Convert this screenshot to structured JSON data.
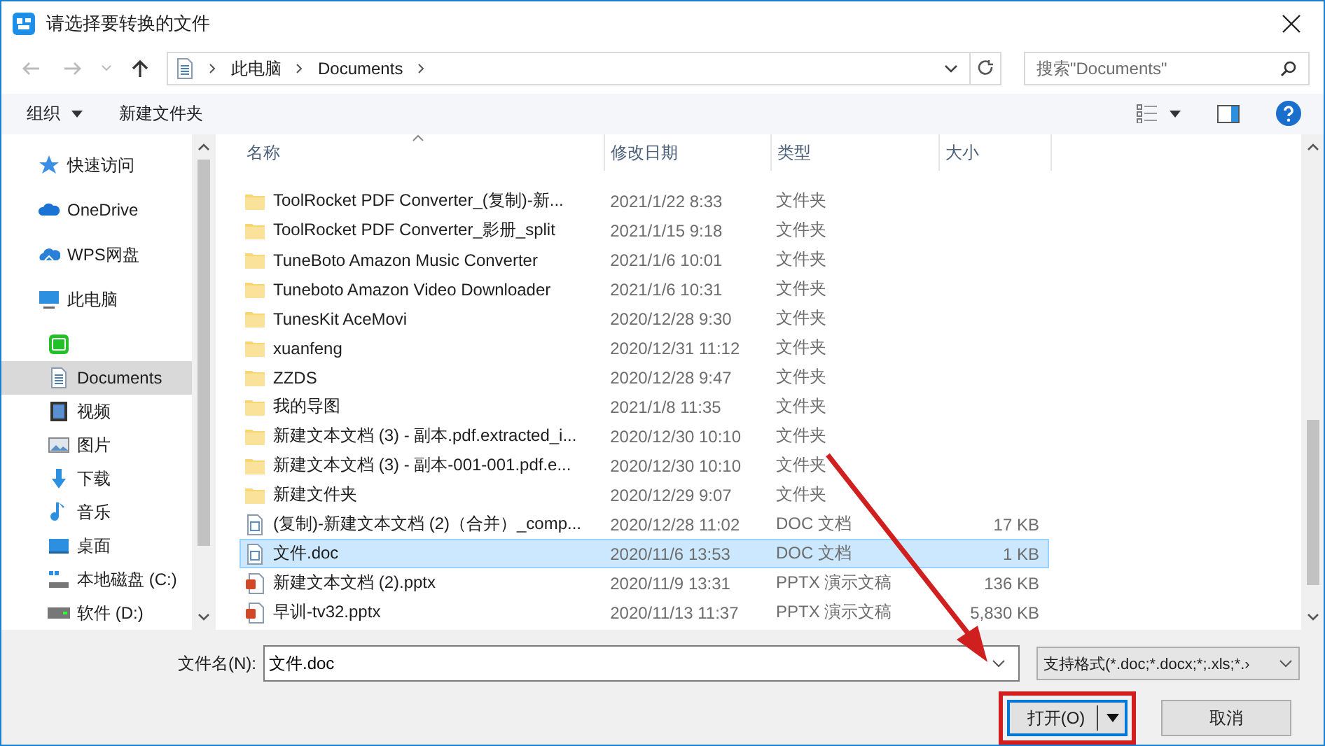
{
  "window": {
    "title": "请选择要转换的文件"
  },
  "address_bar": {
    "path": [
      "此电脑",
      "Documents"
    ],
    "search": {
      "placeholder": "搜索\"Documents\""
    }
  },
  "toolbar": {
    "organize": "组织",
    "new_folder": "新建文件夹"
  },
  "sidebar": {
    "items": [
      {
        "kind": "star",
        "label": "快速访问",
        "selected": false
      },
      {
        "kind": "cloud",
        "label": "OneDrive",
        "selected": false
      },
      {
        "kind": "wps",
        "label": "WPS网盘",
        "selected": false
      },
      {
        "kind": "pc",
        "label": "此电脑",
        "selected": false,
        "children": [
          {
            "kind": "iqiyi",
            "selected": false
          },
          {
            "kind": "doc",
            "label": "Documents",
            "selected": true
          },
          {
            "kind": "video",
            "label": "视频",
            "selected": false
          },
          {
            "kind": "picture",
            "label": "图片",
            "selected": false
          },
          {
            "kind": "download",
            "label": "下载",
            "selected": false
          },
          {
            "kind": "music",
            "label": "音乐",
            "selected": false
          },
          {
            "kind": "desktop",
            "label": "桌面",
            "selected": false
          },
          {
            "kind": "sysdrive",
            "label": "本地磁盘 (C:)",
            "selected": false
          },
          {
            "kind": "drive",
            "label": "软件 (D:)",
            "selected": false
          }
        ]
      }
    ]
  },
  "table": {
    "columns": [
      "名称",
      "修改日期",
      "类型",
      "大小"
    ],
    "rows": [
      {
        "kind": "folder",
        "name": "ToolRocket PDF Converter_(复制)-新...",
        "date": "2021/1/22 8:33",
        "type": "文件夹",
        "selected": false
      },
      {
        "kind": "folder",
        "name": "ToolRocket PDF Converter_影册_split",
        "date": "2021/1/15 9:18",
        "type": "文件夹",
        "selected": false
      },
      {
        "kind": "folder",
        "name": "TuneBoto Amazon Music Converter",
        "date": "2021/1/6 10:01",
        "type": "文件夹",
        "selected": false
      },
      {
        "kind": "folder",
        "name": "Tuneboto Amazon Video Downloader",
        "date": "2021/1/6 10:31",
        "type": "文件夹",
        "selected": false
      },
      {
        "kind": "folder",
        "name": "TunesKit AceMovi",
        "date": "2020/12/28 9:30",
        "type": "文件夹",
        "selected": false
      },
      {
        "kind": "folder",
        "name": "xuanfeng",
        "date": "2020/12/31 11:12",
        "type": "文件夹",
        "selected": false
      },
      {
        "kind": "folder",
        "name": "ZZDS",
        "date": "2020/12/28 9:47",
        "type": "文件夹",
        "selected": false
      },
      {
        "kind": "folder",
        "name": "我的导图",
        "date": "2021/1/8 11:35",
        "type": "文件夹",
        "selected": false
      },
      {
        "kind": "folder",
        "name": "新建文本文档 (3) - 副本.pdf.extracted_i...",
        "date": "2020/12/30 10:10",
        "type": "文件夹",
        "selected": false
      },
      {
        "kind": "folder",
        "name": "新建文本文档 (3) - 副本-001-001.pdf.e...",
        "date": "2020/12/30 10:10",
        "type": "文件夹",
        "selected": false
      },
      {
        "kind": "folder",
        "name": "新建文件夹",
        "date": "2020/12/29 9:07",
        "type": "文件夹",
        "selected": false
      },
      {
        "kind": "doc",
        "name": "(复制)-新建文本文档 (2)（合并）_comp...",
        "date": "2020/12/28 11:02",
        "type": "DOC 文档",
        "size": "17 KB",
        "selected": false
      },
      {
        "kind": "doc",
        "name": "文件.doc",
        "date": "2020/11/6 13:53",
        "type": "DOC 文档",
        "size": "1 KB",
        "selected": true
      },
      {
        "kind": "pptx",
        "name": "新建文本文档 (2).pptx",
        "date": "2020/11/9 13:31",
        "type": "PPTX 演示文稿",
        "size": "136 KB",
        "selected": false
      },
      {
        "kind": "pptx",
        "name": "早训-tv32.pptx",
        "date": "2020/11/13 11:37",
        "type": "PPTX 演示文稿",
        "size": "5,830 KB",
        "selected": false
      }
    ]
  },
  "footer": {
    "filename_label": "文件名(N):",
    "filename": "文件.doc",
    "filter": "支持格式(*.doc;*.docx;*;.xls;*.›",
    "buttons": [
      {
        "kind": "split",
        "label": "打开(O)",
        "highlighted": true
      },
      {
        "kind": "plain",
        "label": "取消"
      }
    ]
  },
  "annotation": {
    "arrow": true
  }
}
